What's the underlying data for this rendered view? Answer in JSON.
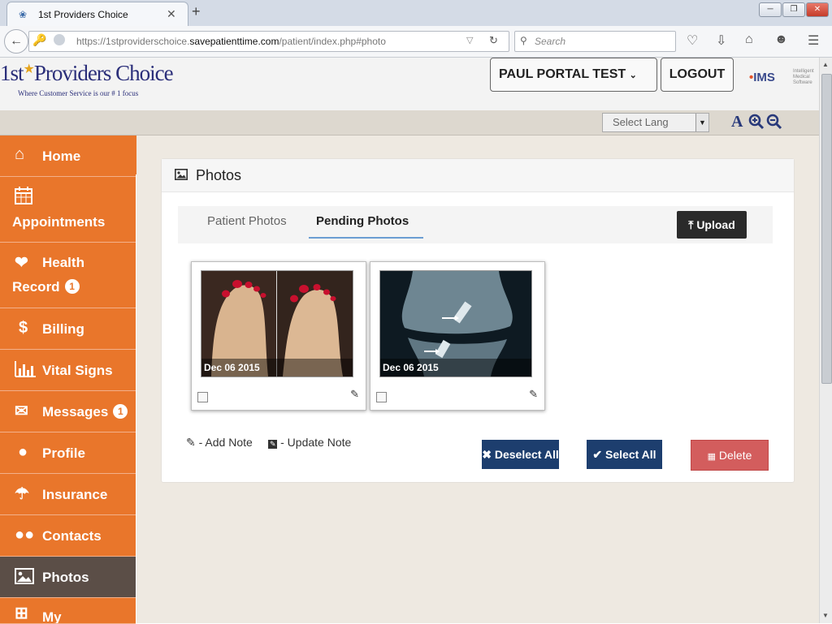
{
  "browser": {
    "tab_title": "1st Providers Choice",
    "tab_close": "✕",
    "new_tab": "+",
    "url_host_prefix": "https://1stproviderschoice.",
    "url_host_domain": "savepatienttime.com",
    "url_path": "/patient/index.php#photo",
    "search_placeholder": "Search",
    "window_controls": [
      "minimize",
      "restore",
      "close"
    ]
  },
  "header": {
    "logo_prefix": "1st",
    "logo_name": "Providers Choice",
    "logo_tagline": "Where Customer Service is our # 1 focus",
    "user_menu_label": "PAUL PORTAL TEST",
    "logout_label": "LOGOUT",
    "partner_logo": "IMS",
    "partner_tagline": "Intelligent Medical Software"
  },
  "langbar": {
    "select_language": "Select Lang",
    "font_normal": "A"
  },
  "sidebar": {
    "items": [
      {
        "label": "Home",
        "icon": "home-icon",
        "badge": ""
      },
      {
        "label": "Appointments",
        "icon": "calendar-icon",
        "badge": ""
      },
      {
        "label": "Health",
        "label2": "Record",
        "icon": "heartbeat-icon",
        "badge": "1"
      },
      {
        "label": "Billing",
        "icon": "dollar-icon",
        "badge": ""
      },
      {
        "label": "Vital Signs",
        "icon": "bar-chart-icon",
        "badge": ""
      },
      {
        "label": "Messages",
        "icon": "envelope-icon",
        "badge": "1"
      },
      {
        "label": "Profile",
        "icon": "user-icon",
        "badge": ""
      },
      {
        "label": "Insurance",
        "icon": "umbrella-icon",
        "badge": ""
      },
      {
        "label": "Contacts",
        "icon": "users-icon",
        "badge": ""
      },
      {
        "label": "Photos",
        "icon": "image-icon",
        "badge": "",
        "active": true
      },
      {
        "label": "My",
        "icon": "plus-square-icon",
        "badge": ""
      }
    ]
  },
  "panel": {
    "title": "Photos",
    "tabs": [
      {
        "label": "Patient Photos",
        "active": false
      },
      {
        "label": "Pending Photos",
        "active": true
      }
    ],
    "upload_label": "Upload",
    "photos": [
      {
        "date": "Dec 06 2015",
        "subject": "feet"
      },
      {
        "date": "Dec 06 2015",
        "subject": "knee x-ray"
      }
    ],
    "add_note_label": "- Add Note",
    "update_note_label": "- Update Note",
    "deselect_label": "Deselect All",
    "select_all_label": "Select All",
    "delete_label": "Delete"
  },
  "colors": {
    "sidebar": "#e9762b",
    "sidebar_active": "#5b4e47",
    "primary_button": "#1d3e6e",
    "danger_button": "#d35d5d"
  }
}
